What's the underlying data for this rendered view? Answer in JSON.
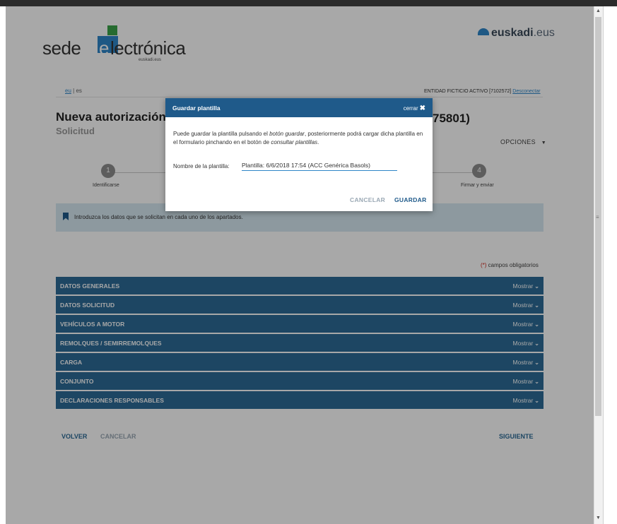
{
  "header": {
    "logo_sede": "sede",
    "logo_e": "e",
    "logo_lectronica": "lectrónica",
    "logo_sub": "euskadi.eus",
    "euskadi_brand": "euskadi",
    "euskadi_tld": ".eus"
  },
  "lang": {
    "eu": "eu",
    "sep": " | ",
    "es": "es"
  },
  "entity": {
    "text": "ENTIDAD FICTICIO ACTIVO [7102572] ",
    "logout": "Desconectar"
  },
  "page": {
    "title": "Nueva autorización c",
    "title_tail": "75801)",
    "subtitle": "Solicitud",
    "options": "OPCIONES"
  },
  "steps": [
    {
      "num": "1",
      "label": "Identificarse"
    },
    {
      "num": "4",
      "label": "Firmar y enviar"
    }
  ],
  "info": {
    "text": "Introduzca los datos que se solicitan en cada uno de los apartados."
  },
  "required": {
    "ast": "(*)",
    "text": " campos obligatorios"
  },
  "sections": [
    {
      "label": "DATOS GENERALES",
      "action": "Mostrar"
    },
    {
      "label": "DATOS SOLICITUD",
      "action": "Mostrar"
    },
    {
      "label": "VEHÍCULOS A MOTOR",
      "action": "Mostrar"
    },
    {
      "label": "REMOLQUES / SEMIRREMOLQUES",
      "action": "Mostrar"
    },
    {
      "label": "CARGA",
      "action": "Mostrar"
    },
    {
      "label": "CONJUNTO",
      "action": "Mostrar"
    },
    {
      "label": "DECLARACIONES RESPONSABLES",
      "action": "Mostrar"
    }
  ],
  "footer": {
    "back": "VOLVER",
    "cancel": "CANCELAR",
    "next": "SIGUIENTE"
  },
  "modal": {
    "title": "Guardar plantilla",
    "close": "cerrar",
    "text_1": "Puede guardar la plantilla pulsando el ",
    "text_em1": "botón guardar",
    "text_2": ", posteriormente podrá cargar dicha plantilla en el formulario pinchando en el botón de ",
    "text_em2": "consultar plantillas",
    "text_3": ".",
    "field_label": "Nombre de la plantilla:",
    "field_value": "Plantilla: 6/6/2018 17:54 (ACC Genérica Basols)",
    "cancel": "CANCELAR",
    "save": "GUARDAR"
  }
}
